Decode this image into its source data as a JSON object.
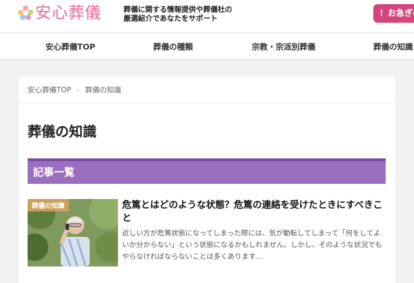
{
  "header": {
    "logo_text": "安心葬儀",
    "tagline_line1": "葬儀に関する情報提供や葬儀社の",
    "tagline_line2": "厳選紹介であなたをサポート",
    "contact_label": "！お急ぎの方",
    "brand_color": "#e76a93",
    "button_color": "#d4467b"
  },
  "nav": {
    "items": [
      {
        "label": "安心葬儀TOP"
      },
      {
        "label": "葬儀の種類"
      },
      {
        "label": "宗教・宗派別葬儀"
      },
      {
        "label": "葬儀の知識"
      }
    ]
  },
  "breadcrumb": {
    "home": "安心葬儀TOP",
    "current": "葬儀の知識"
  },
  "page": {
    "title": "葬儀の知識",
    "section_heading": "記事一覧",
    "section_color": "#9c6fbe"
  },
  "articles": [
    {
      "badge": "葬儀の知識",
      "title": "危篤とはどのような状態？危篤の連絡を受けたときにすべきこと",
      "excerpt": "近しい方が危篤状態になってしまった際には、気が動転してしまって「何をしてよいか分からない」という状態になるかもしれません。しかし、そのような状況でもやらなければならないことは多くあります..."
    }
  ]
}
